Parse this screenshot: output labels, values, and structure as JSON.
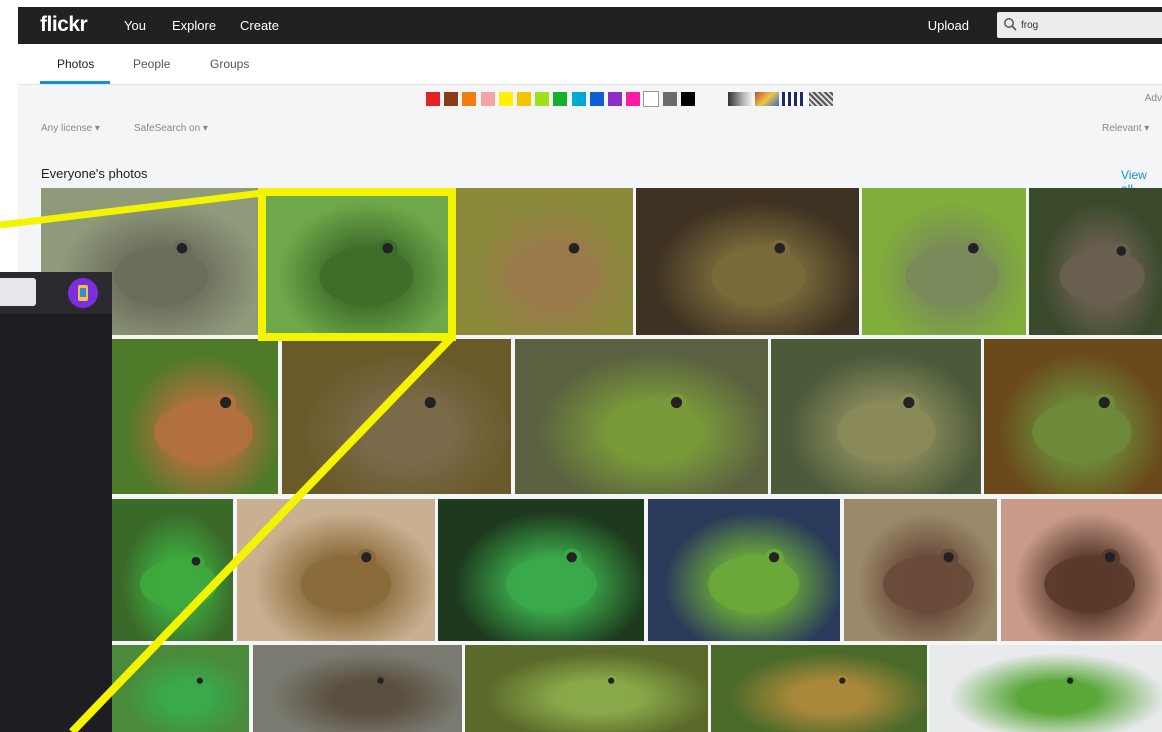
{
  "header": {
    "logo": "flickr",
    "nav": [
      "You",
      "Explore",
      "Create"
    ],
    "upload_label": "Upload",
    "search_value": "frog"
  },
  "subnav": {
    "tabs": [
      "Photos",
      "People",
      "Groups"
    ],
    "active_tab": "Photos"
  },
  "filters": {
    "license": "Any license ▾",
    "safesearch": "SafeSearch on ▾",
    "sort": "Relevant ▾",
    "advanced": "Adv",
    "color_swatches": [
      "#e52222",
      "#8a3d12",
      "#f07f0d",
      "#f5a3a6",
      "#fff200",
      "#f5c400",
      "#9fe01a",
      "#15b02c",
      "#00a9d4",
      "#0c5fd4",
      "#8a2fc9",
      "#ff1aa3",
      "#ffffff",
      "#6b6b6b",
      "#000000"
    ],
    "style_swatches": [
      "black-and-white",
      "shallow-depth",
      "minimalist",
      "patterns"
    ]
  },
  "section": {
    "title": "Everyone's photos",
    "view_all": "View all"
  },
  "photos": [
    {
      "row": 1,
      "tone": "#8f9a7a",
      "subject": "#6b6e5c"
    },
    {
      "row": 1,
      "tone": "#6fa84a",
      "subject": "#3d6e2a"
    },
    {
      "row": 1,
      "tone": "#8a8a3a",
      "subject": "#9a7a4a"
    },
    {
      "row": 1,
      "tone": "#3e3222",
      "subject": "#7a6a3a"
    },
    {
      "row": 1,
      "tone": "#7fae3a",
      "subject": "#7a8a5a"
    },
    {
      "row": 1,
      "tone": "#3a4a2a",
      "subject": "#6a6050"
    },
    {
      "row": 2,
      "tone": "#4e7a2a",
      "subject": "#b2703e"
    },
    {
      "row": 2,
      "tone": "#6a5a2a",
      "subject": "#7a6a4a"
    },
    {
      "row": 2,
      "tone": "#5a6040",
      "subject": "#7a9a3a"
    },
    {
      "row": 2,
      "tone": "#4a5a3a",
      "subject": "#8a8a5a"
    },
    {
      "row": 2,
      "tone": "#6a4a1a",
      "subject": "#6e8a3a"
    },
    {
      "row": 3,
      "tone": "#3a6a2a",
      "subject": "#3ea83e"
    },
    {
      "row": 3,
      "tone": "#c8b090",
      "subject": "#8a6a3a"
    },
    {
      "row": 3,
      "tone": "#1e3a1e",
      "subject": "#3aa84a"
    },
    {
      "row": 3,
      "tone": "#2a3a5a",
      "subject": "#6aa83a"
    },
    {
      "row": 3,
      "tone": "#9a8a6a",
      "subject": "#6a4a3a"
    },
    {
      "row": 3,
      "tone": "#c89a8a",
      "subject": "#5a3a2a"
    },
    {
      "row": 4,
      "tone": "#4a8a3a",
      "subject": "#3aa84a"
    },
    {
      "row": 4,
      "tone": "#7a7a70",
      "subject": "#5a5040"
    },
    {
      "row": 4,
      "tone": "#5a6a2a",
      "subject": "#8aa84a"
    },
    {
      "row": 4,
      "tone": "#4a6a2a",
      "subject": "#a8883a"
    },
    {
      "row": 4,
      "tone": "#e8eaec",
      "subject": "#5aa83a"
    }
  ]
}
